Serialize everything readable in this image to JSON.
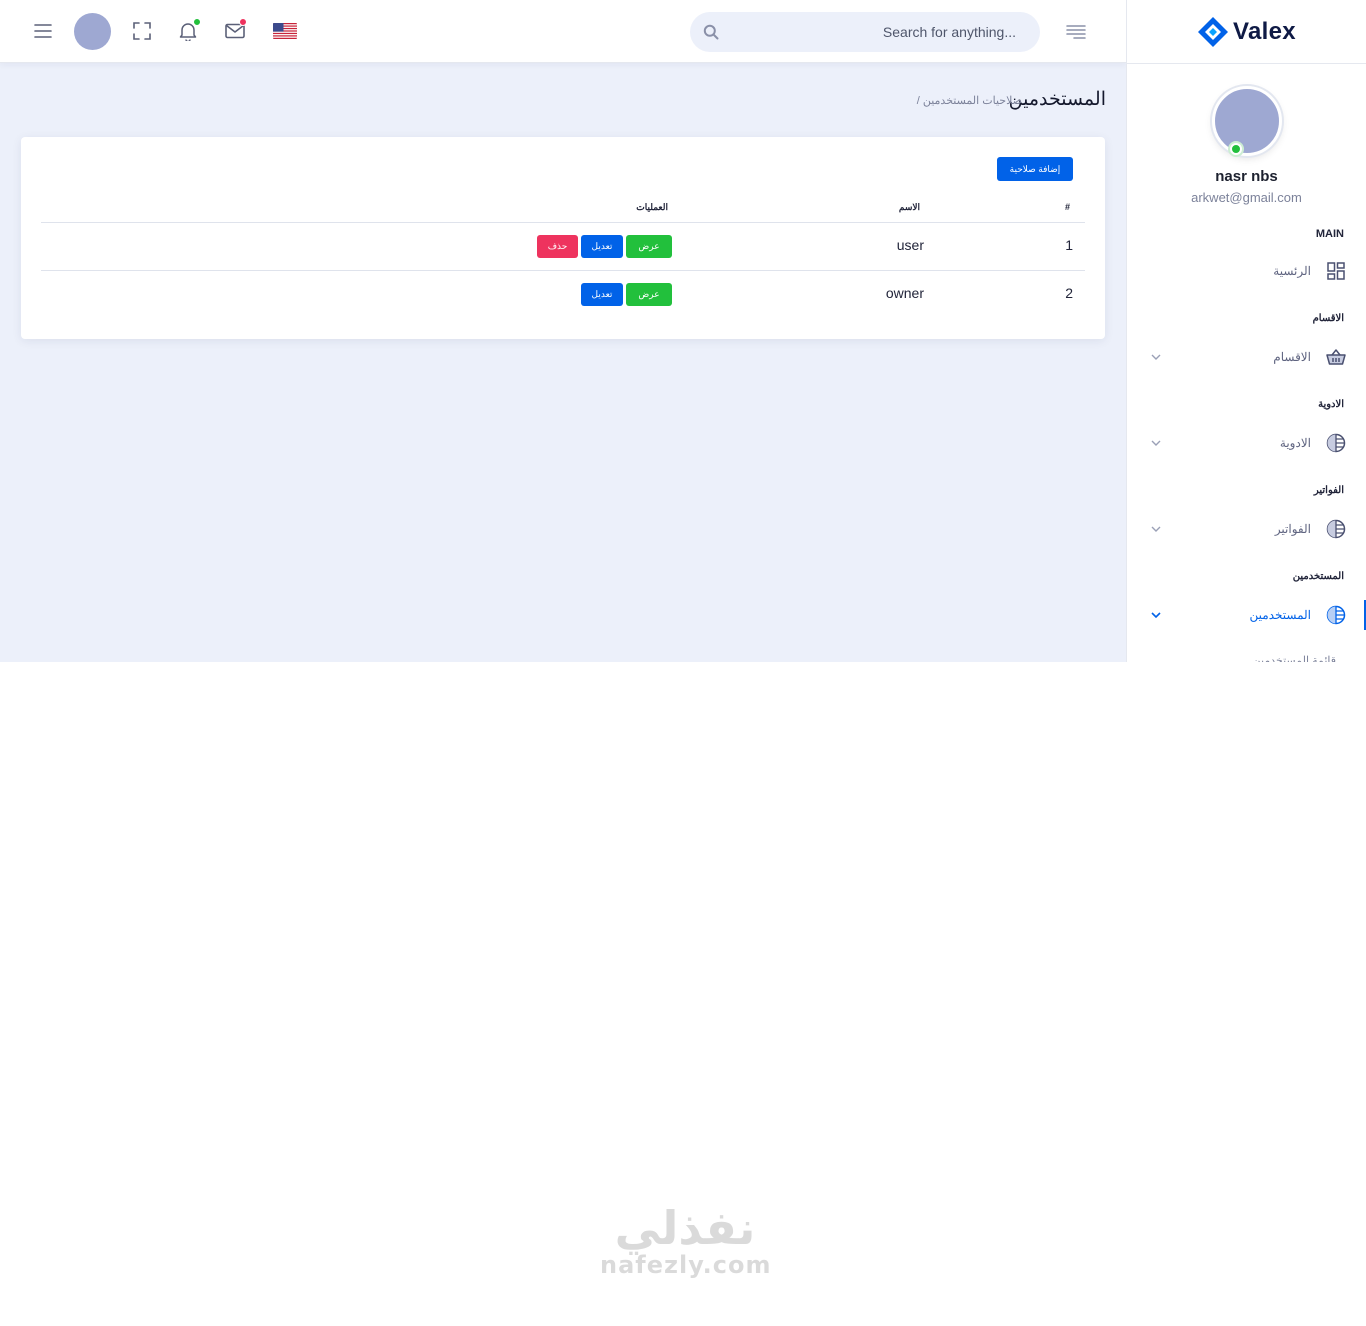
{
  "header": {
    "search_placeholder": "Search for anything..."
  },
  "sidebar": {
    "brand": "Valex",
    "user_name": "nasr nbs",
    "user_email": "arkwet@gmail.com",
    "main_label": "MAIN",
    "dashboard": "الرئسية",
    "cat_sections": "الاقسام",
    "sections": "الاقسام",
    "cat_medicines": "الادوية",
    "medicines": "الادوية",
    "cat_invoices": "الفواتير",
    "invoices": "الفواتير",
    "cat_users": "المستخدمين",
    "users": "المستخدمين",
    "users_list": "قائمة المستخدمين"
  },
  "page": {
    "title": "المستخدمين",
    "breadcrumb": "/ صلاحيات المستخدمين"
  },
  "card": {
    "add_button": "إضافة صلاحية",
    "columns": {
      "num": "#",
      "name": "الاسم",
      "actions": "العمليات"
    },
    "rows": [
      {
        "num": "1",
        "name": "user",
        "show": "عرض",
        "edit": "تعديل",
        "delete": "حذف"
      },
      {
        "num": "2",
        "name": "owner",
        "show": "عرض",
        "edit": "تعديل"
      }
    ]
  },
  "watermark": {
    "arabic": "نفذلي",
    "latin": "nafezly.com"
  },
  "colors": {
    "primary": "#0162e8",
    "success": "#22c03c",
    "danger": "#ee335e",
    "body_bg": "#ecf0fa"
  }
}
